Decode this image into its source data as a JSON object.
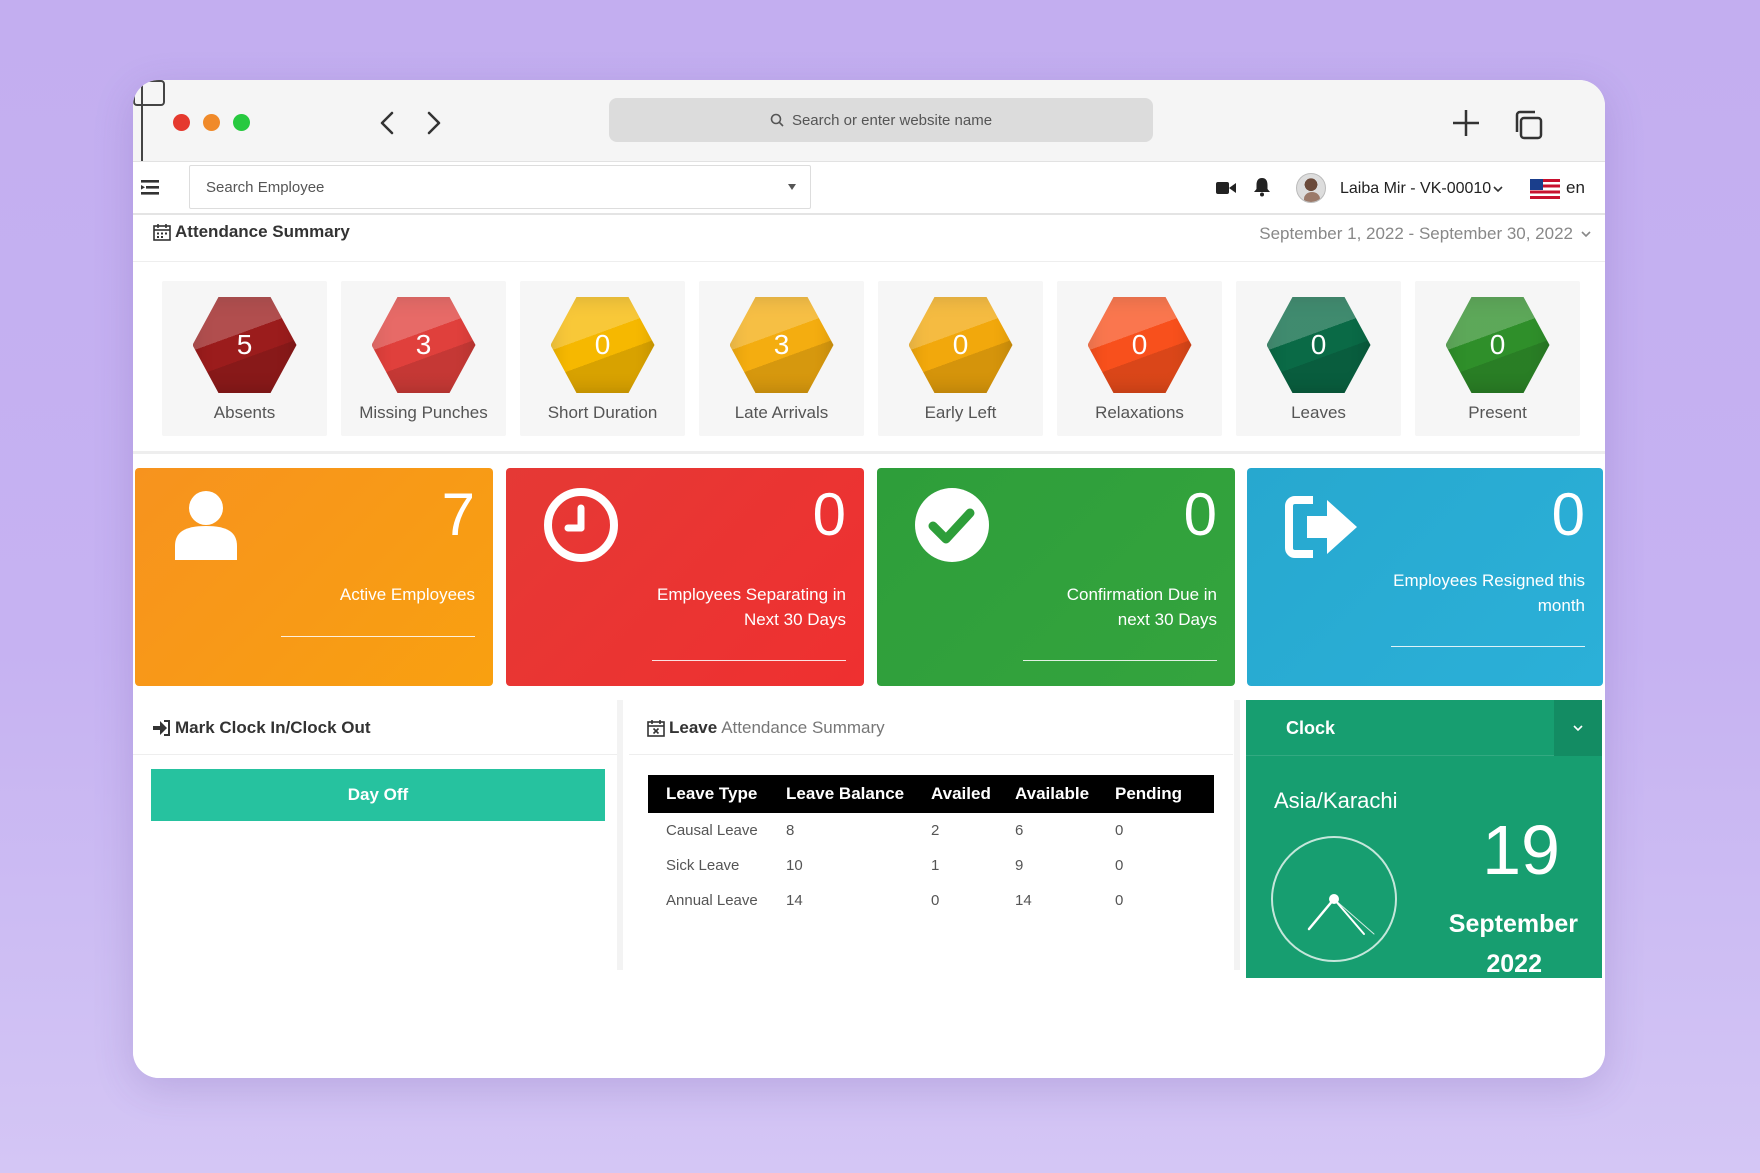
{
  "browser": {
    "address_placeholder": "Search or enter website name"
  },
  "topbar": {
    "employee_search": "Search Employee",
    "user_name": "Laiba Mir - VK-00010",
    "language": "en"
  },
  "attendance": {
    "title": "Attendance Summary",
    "date_range": "September 1, 2022 - September 30, 2022",
    "stats": [
      {
        "label": "Absents",
        "value": "5",
        "color": "#9b1c1c"
      },
      {
        "label": "Missing Punches",
        "value": "3",
        "color": "#e0403c"
      },
      {
        "label": "Short Duration",
        "value": "0",
        "color": "#f6b800"
      },
      {
        "label": "Late Arrivals",
        "value": "3",
        "color": "#f4ad10"
      },
      {
        "label": "Early Left",
        "value": "0",
        "color": "#f2a80c"
      },
      {
        "label": "Relaxations",
        "value": "0",
        "color": "#f8501c"
      },
      {
        "label": "Leaves",
        "value": "0",
        "color": "#0a6a46"
      },
      {
        "label": "Present",
        "value": "0",
        "color": "#2f8f2a"
      }
    ]
  },
  "kpis": [
    {
      "value": "7",
      "label_line1": "Active Employees",
      "label_line2": "",
      "icon": "user-icon"
    },
    {
      "value": "0",
      "label_line1": "Employees Separating in",
      "label_line2": "Next 30 Days",
      "icon": "clock-icon"
    },
    {
      "value": "0",
      "label_line1": "Confirmation Due in",
      "label_line2": "next 30 Days",
      "icon": "check-circle-icon"
    },
    {
      "value": "0",
      "label_line1": "Employees Resigned this",
      "label_line2": "month",
      "icon": "sign-out-icon"
    }
  ],
  "clock_in": {
    "title": "Mark Clock In/Clock Out",
    "button": "Day Off"
  },
  "leave_summary": {
    "title_strong": "Leave",
    "title_light": "Attendance Summary",
    "headers": [
      "Leave Type",
      "Leave Balance",
      "Availed",
      "Available",
      "Pending"
    ],
    "rows": [
      [
        "Causal Leave",
        "8",
        "2",
        "6",
        "0"
      ],
      [
        "Sick Leave",
        "10",
        "1",
        "9",
        "0"
      ],
      [
        "Annual Leave",
        "14",
        "0",
        "14",
        "0"
      ]
    ]
  },
  "clock_widget": {
    "title": "Clock",
    "timezone": "Asia/Karachi",
    "day": "19",
    "month": "September",
    "year": "2022"
  }
}
